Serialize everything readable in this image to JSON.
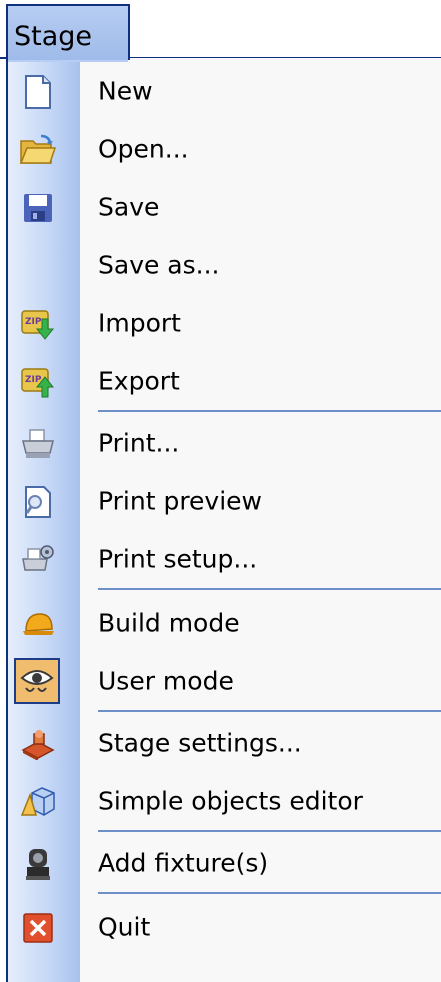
{
  "menu": {
    "title": "Stage",
    "items": [
      {
        "label": "New",
        "icon": "new-document-icon"
      },
      {
        "label": "Open...",
        "icon": "open-folder-icon"
      },
      {
        "label": "Save",
        "icon": "save-floppy-icon"
      },
      {
        "label": "Save as...",
        "icon": ""
      },
      {
        "label": "Import",
        "icon": "zip-import-icon"
      },
      {
        "label": "Export",
        "icon": "zip-export-icon"
      },
      {
        "label": "Print...",
        "icon": "printer-icon"
      },
      {
        "label": "Print preview",
        "icon": "print-preview-icon"
      },
      {
        "label": "Print setup...",
        "icon": "print-setup-icon"
      },
      {
        "label": "Build mode",
        "icon": "hard-hat-icon"
      },
      {
        "label": "User mode",
        "icon": "eye-user-mode-icon"
      },
      {
        "label": "Stage settings...",
        "icon": "stage-settings-icon"
      },
      {
        "label": "Simple objects editor",
        "icon": "objects-editor-icon"
      },
      {
        "label": "Add fixture(s)",
        "icon": "fixture-light-icon"
      },
      {
        "label": "Quit",
        "icon": "quit-close-icon"
      }
    ]
  },
  "colors": {
    "accent_border": "#0f2f7f",
    "gutter": "#c6d8f6",
    "selected_icon_bg": "#f0bd6e",
    "separator": "#6f8fc8"
  }
}
